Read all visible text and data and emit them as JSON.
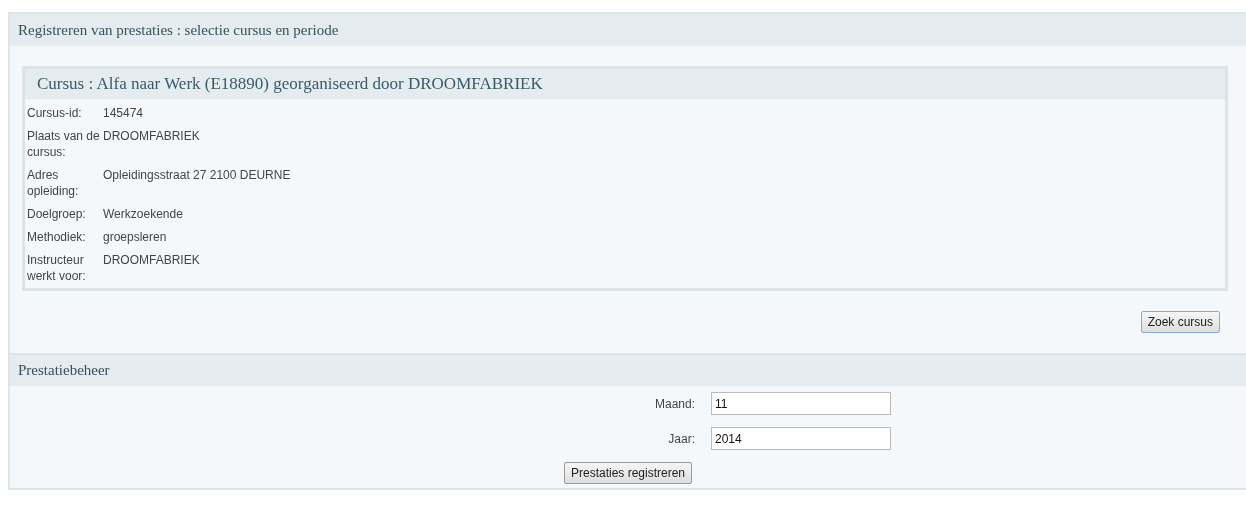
{
  "page_title": "Registreren van prestaties : selectie cursus en periode",
  "course": {
    "title": "Cursus : Alfa naar Werk (E18890) georganiseerd door DROOMFABRIEK",
    "fields": [
      {
        "label": "Cursus-id:",
        "value": "145474"
      },
      {
        "label": "Plaats van de cursus:",
        "value": "DROOMFABRIEK"
      },
      {
        "label": "Adres opleiding:",
        "value": "Opleidingsstraat 27  2100 DEURNE"
      },
      {
        "label": "Doelgroep:",
        "value": "Werkzoekende"
      },
      {
        "label": "Methodiek:",
        "value": "groepsleren"
      },
      {
        "label": "Instructeur werkt voor:",
        "value": "DROOMFABRIEK"
      }
    ]
  },
  "search_button": "Zoek cursus",
  "management": {
    "title": "Prestatiebeheer",
    "inputs": [
      {
        "label": "Maand:",
        "value": "11"
      },
      {
        "label": "Jaar:",
        "value": "2014"
      }
    ],
    "button": "Prestaties registreren"
  }
}
